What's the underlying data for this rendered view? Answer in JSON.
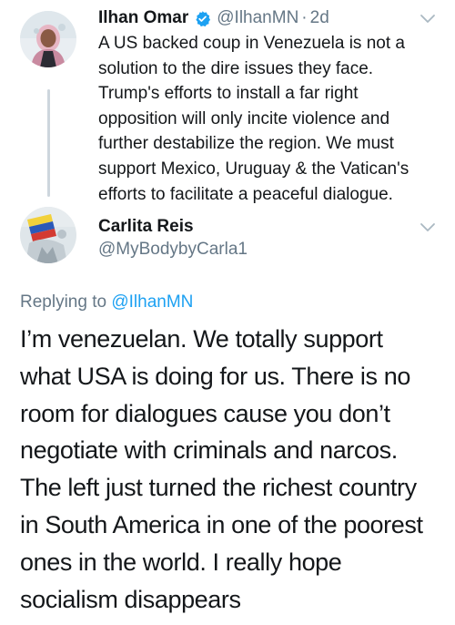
{
  "tweet": {
    "author_name": "Ilhan Omar",
    "author_handle": "@IlhanMN",
    "separator": "·",
    "time": "2d",
    "verified_icon": "verified-badge-icon",
    "text": "A US backed coup in Venezuela is not a\nsolution to the dire issues they face.\nTrump's efforts to install a far right\nopposition will only incite violence and\nfurther destabilize the region. We must\nsupport Mexico, Uruguay & the Vatican's\nefforts to facilitate a peaceful dialogue."
  },
  "reply": {
    "author_name": "Carlita Reis",
    "author_handle": "@MyBodybyCarla1",
    "replying_prefix": "Replying to ",
    "replying_to": "@IlhanMN",
    "text": "I’m venezuelan. We totally support\nwhat USA is doing for us. There is no\nroom for dialogues cause you don’t\nnegotiate with criminals and narcos.\nThe left just turned the richest country\nin South America in one of the poorest\nones in the world. I really hope\nsocialism disappears"
  },
  "colors": {
    "text_primary": "#14171a",
    "text_secondary": "#657786",
    "link": "#1da1f2",
    "verified": "#1da1f2",
    "thread_line": "#cdd6dd"
  }
}
